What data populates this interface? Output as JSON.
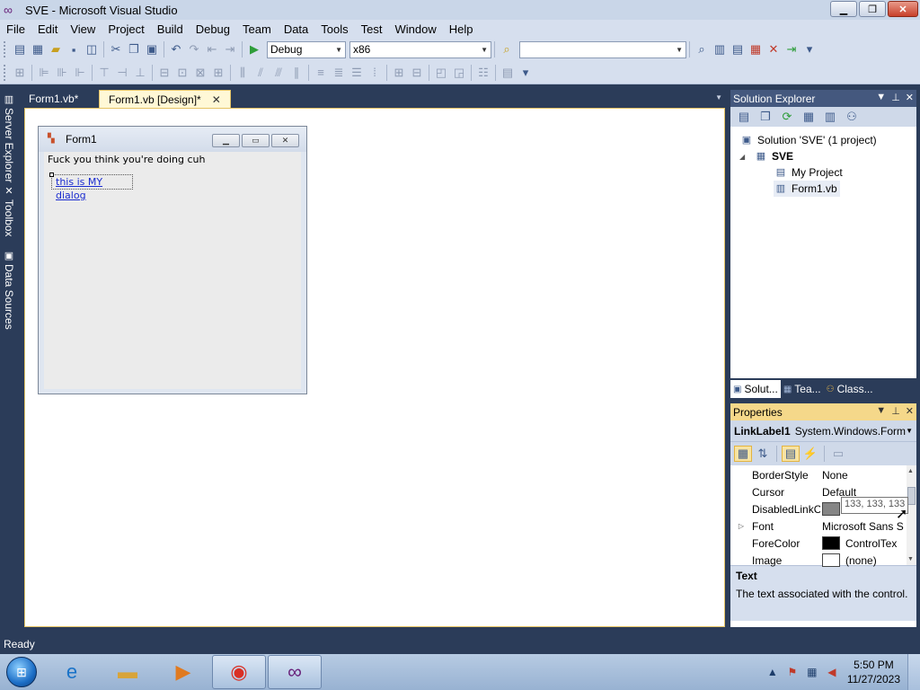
{
  "window": {
    "title": "SVE - Microsoft Visual Studio",
    "app_icon": "visual-studio-icon",
    "controls": [
      "minimize",
      "maximize",
      "close"
    ]
  },
  "menu": [
    "File",
    "Edit",
    "View",
    "Project",
    "Build",
    "Debug",
    "Team",
    "Data",
    "Tools",
    "Test",
    "Window",
    "Help"
  ],
  "toolbar": {
    "config": "Debug",
    "platform": "x86",
    "find": ""
  },
  "left_tabs": [
    {
      "label": "Server Explorer",
      "icon": "server-explorer-icon"
    },
    {
      "label": "Toolbox",
      "icon": "toolbox-icon"
    },
    {
      "label": "Data Sources",
      "icon": "data-sources-icon"
    }
  ],
  "doc_tabs": [
    {
      "label": "Form1.vb*",
      "active": false
    },
    {
      "label": "Form1.vb [Design]*",
      "active": true
    }
  ],
  "form": {
    "title": "Form1",
    "label_text": "Fuck you think you're doing cuh",
    "link_text": "this is MY dialog "
  },
  "solution_explorer": {
    "title": "Solution Explorer",
    "tree": {
      "solution": "Solution 'SVE' (1 project)",
      "project": "SVE",
      "my_project": "My Project",
      "form_file": "Form1.vb"
    },
    "tabs": [
      "Solut...",
      "Tea...",
      "Class..."
    ]
  },
  "properties": {
    "title": "Properties",
    "object": {
      "name": "LinkLabel1",
      "type": "System.Windows.Form"
    },
    "rows": [
      {
        "name": "BorderStyle",
        "value": "None"
      },
      {
        "name": "Cursor",
        "value": "Default"
      },
      {
        "name": "DisabledLinkColor",
        "value": "",
        "swatch": "#858585"
      },
      {
        "name": "Font",
        "value": "Microsoft Sans S",
        "expandable": true
      },
      {
        "name": "ForeColor",
        "value": "ControlTex",
        "swatch": "#000000"
      },
      {
        "name": "Image",
        "value": "(none)",
        "swatch": "#ffffff"
      }
    ],
    "tooltip": "133, 133, 133",
    "description": {
      "title": "Text",
      "text": "The text associated with the control."
    }
  },
  "status": "Ready",
  "taskbar": {
    "apps": [
      "internet-explorer-icon",
      "file-explorer-icon",
      "media-player-icon",
      "chrome-icon",
      "visual-studio-icon"
    ],
    "time": "5:50 PM",
    "date": "11/27/2023"
  },
  "colors": {
    "chrome_dark": "#2b3c59",
    "active_tab": "#fff8d6",
    "properties_header": "#f5d88a"
  }
}
